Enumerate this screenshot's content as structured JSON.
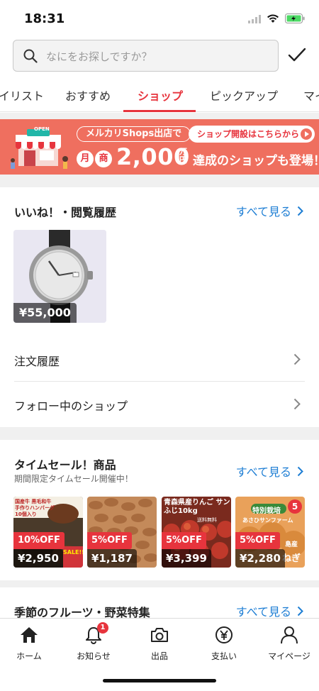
{
  "status": {
    "time": "18:31"
  },
  "search": {
    "placeholder": "なにをお探しですか？"
  },
  "tabs": [
    {
      "label": "イリスト"
    },
    {
      "label": "おすすめ"
    },
    {
      "label": "ショップ",
      "active": true
    },
    {
      "label": "ピックアップ"
    },
    {
      "label": "マイ"
    }
  ],
  "banner": {
    "open_sign": "OPEN",
    "headline": "メルカリShops出店で",
    "cta": "ショップ開設はこちらから",
    "month_1": "月",
    "month_2": "商",
    "amount": "2,000",
    "unit": "万円",
    "rest": "達成のショップも登場！"
  },
  "likes_history": {
    "title": "いいね！・閲覧履歴",
    "see_all": "すべて見る",
    "items": [
      {
        "price": "¥55,000",
        "icon": "wristwatch"
      }
    ]
  },
  "links": [
    {
      "label": "注文履歴"
    },
    {
      "label": "フォロー中のショップ"
    }
  ],
  "time_sale": {
    "title": "タイムセール！商品",
    "subtitle": "期間限定タイムセール開催中！",
    "see_all": "すべて見る",
    "items": [
      {
        "discount": "10%OFF",
        "price": "¥2,950",
        "image_text": "国産牛 黒毛和牛 手作りハンバーグ 10個入り",
        "sale_text": "SALE!!"
      },
      {
        "discount": "5%OFF",
        "price": "¥1,187",
        "image_text": ""
      },
      {
        "discount": "5%OFF",
        "price": "¥3,399",
        "image_text": "青森県産りんご サンふじ10kg",
        "sub_text": "送料無料"
      },
      {
        "discount": "5%OFF",
        "price": "¥2,280",
        "image_text": "特別栽培",
        "sub_text": "あさひサンファーム",
        "badge": "5",
        "tag_1": "島産",
        "tag_2": "ねぎ"
      }
    ]
  },
  "seasonal": {
    "title": "季節のフルーツ・野菜特集",
    "see_all": "すべて見る"
  },
  "tabbar": [
    {
      "label": "ホーム",
      "icon": "home"
    },
    {
      "label": "お知らせ",
      "icon": "bell",
      "badge": "1"
    },
    {
      "label": "出品",
      "icon": "camera"
    },
    {
      "label": "支払い",
      "icon": "yen"
    },
    {
      "label": "マイページ",
      "icon": "person"
    }
  ],
  "colors": {
    "accent": "#e7343d",
    "link": "#1e7ed4",
    "banner": "#ef6f5f"
  }
}
